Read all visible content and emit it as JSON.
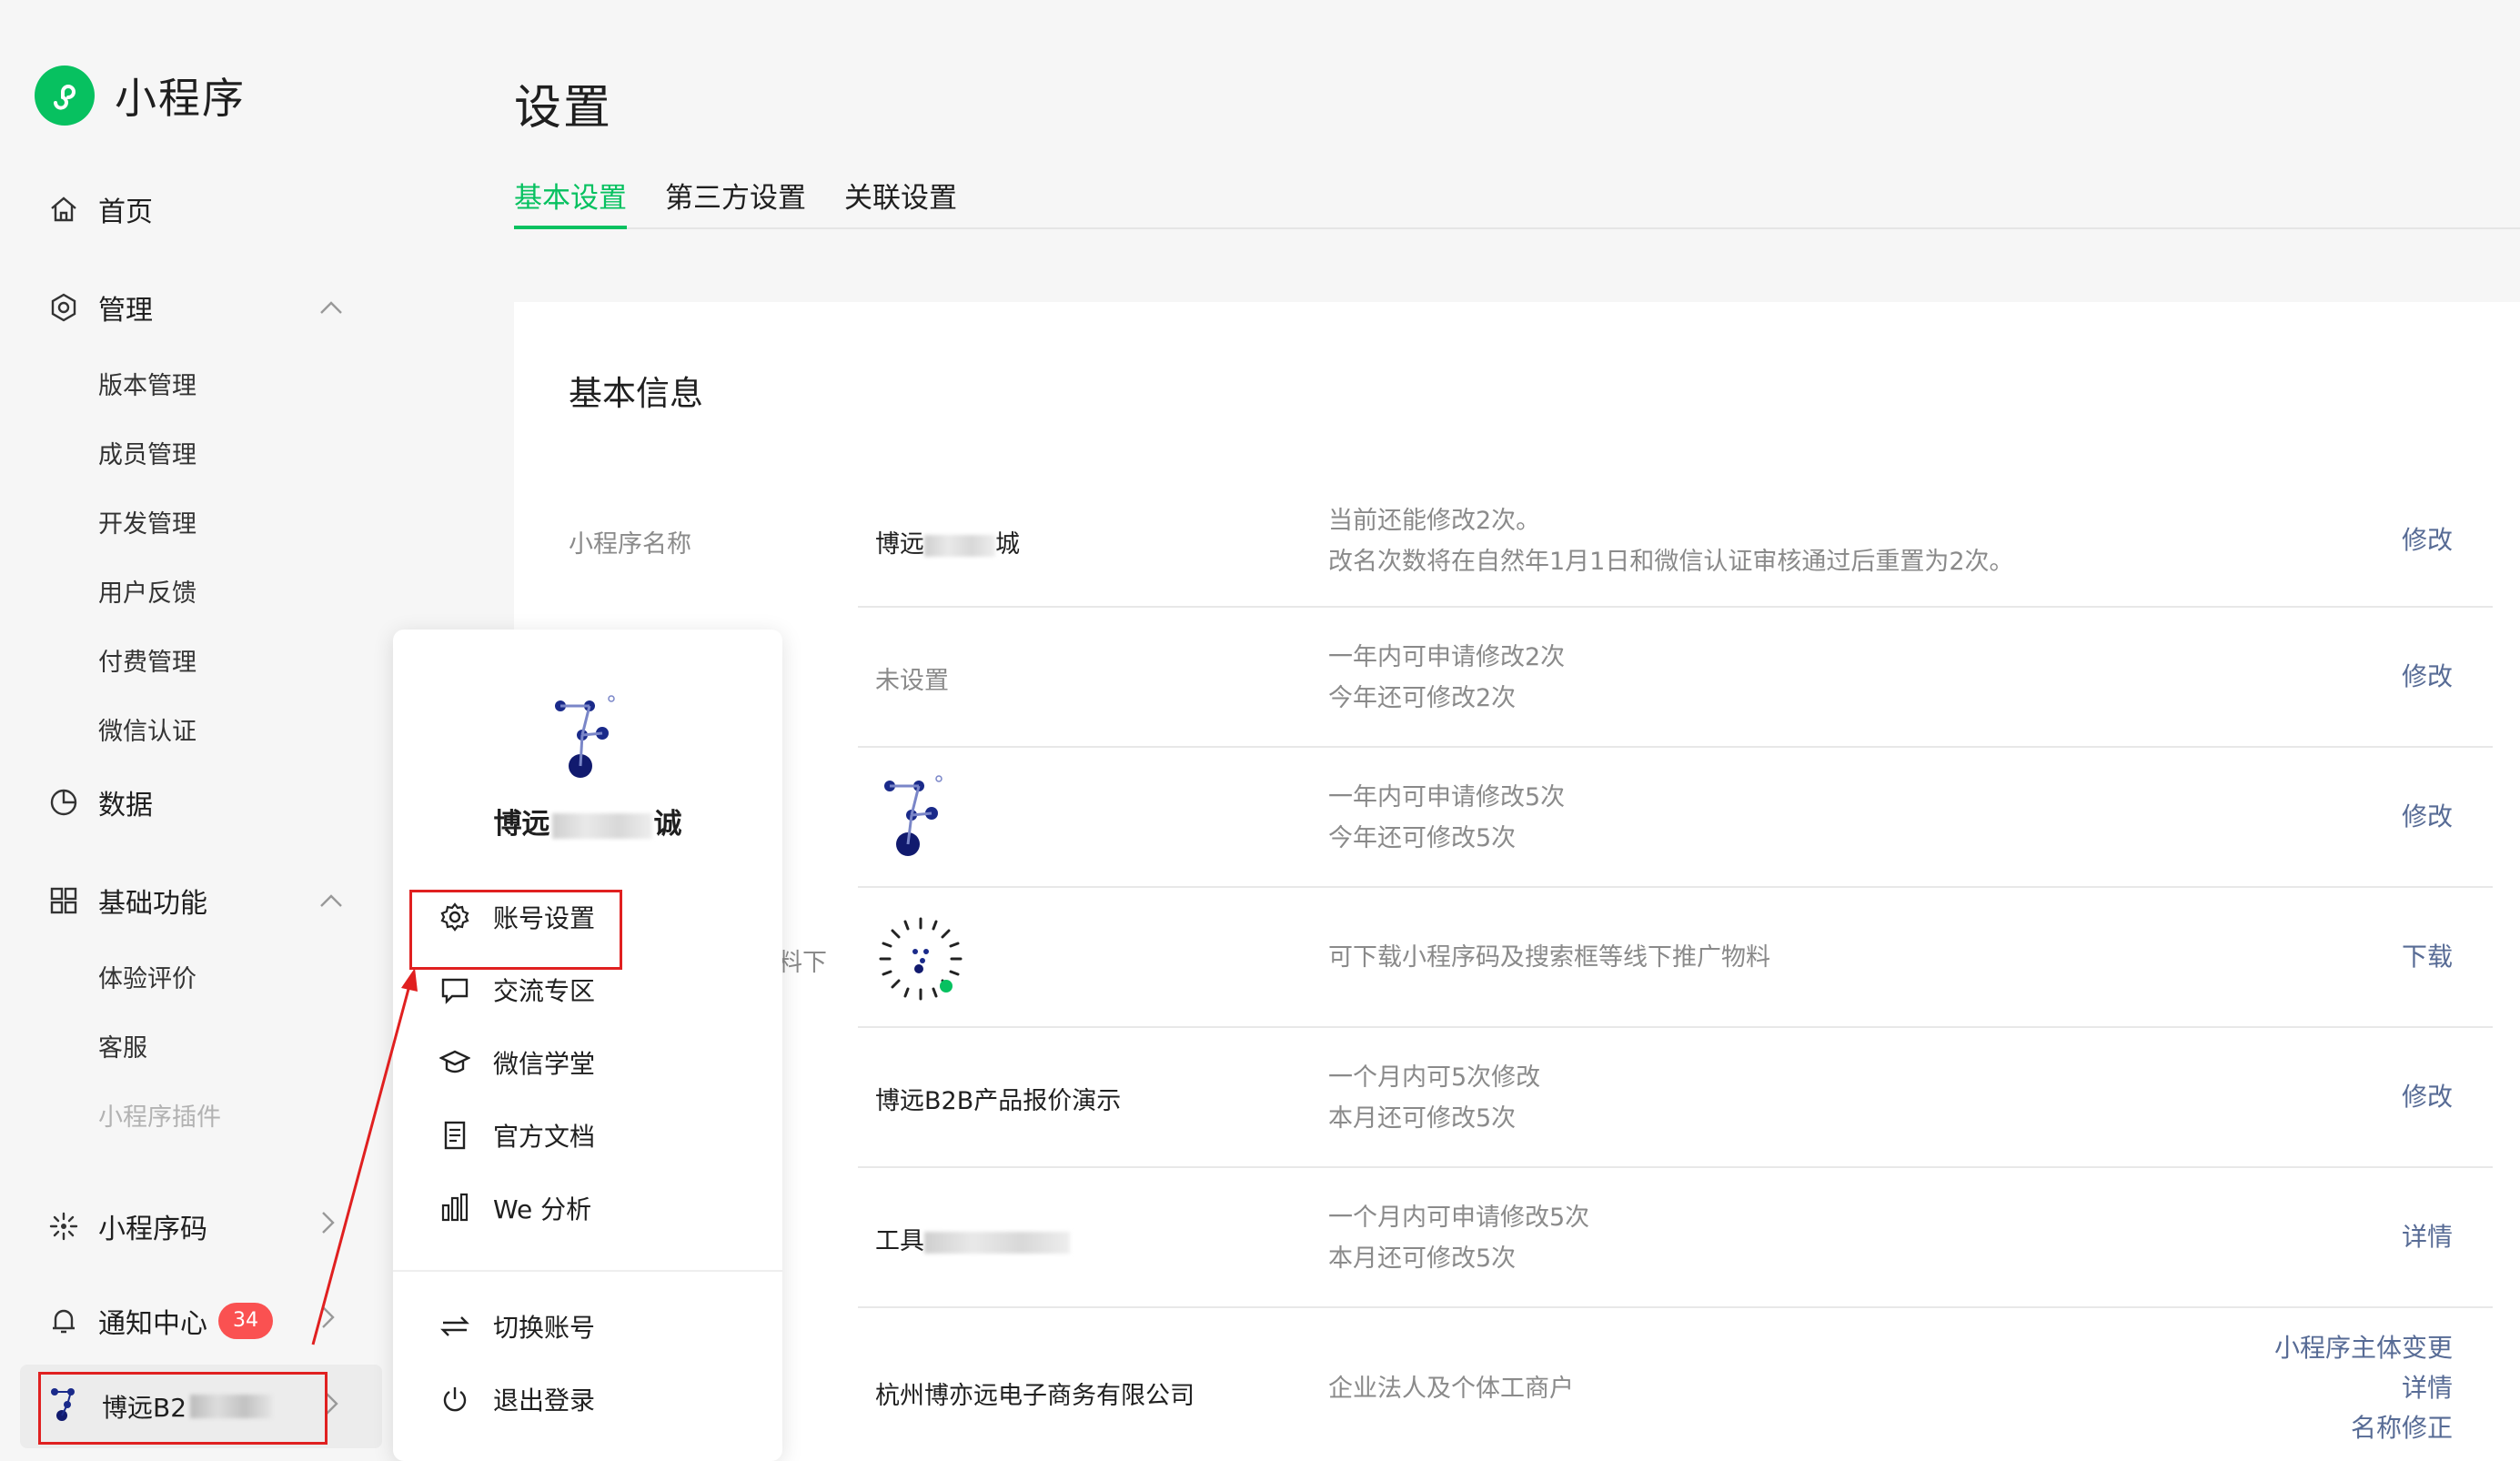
{
  "app": {
    "name": "小程序",
    "logo_icon": "mini-program-logo-icon",
    "accent": "#07c160"
  },
  "sidebar": {
    "home": "首页",
    "manage": {
      "label": "管理",
      "items": [
        "版本管理",
        "成员管理",
        "开发管理",
        "用户反馈",
        "付费管理",
        "微信认证"
      ]
    },
    "data": "数据",
    "basic": {
      "label": "基础功能",
      "items": [
        "体验评价",
        "客服"
      ],
      "disabled_item": "小程序插件"
    },
    "qrcode": "小程序码",
    "notify": {
      "label": "通知中心",
      "badge": "34",
      "badge_color": "#fa5151"
    },
    "account": {
      "name": "博远B2"
    }
  },
  "main": {
    "title": "设置",
    "tabs": [
      "基本设置",
      "第三方设置",
      "关联设置"
    ],
    "card_title": "基本信息",
    "rows": [
      {
        "label": "小程序名称",
        "value_a": "博远",
        "value_b": "城",
        "desc1": "当前还能修改2次。",
        "desc2": "改名次数将在自然年1月1日和微信认证审核通过后重置为2次。",
        "action": "修改"
      },
      {
        "value": "未设置",
        "desc1": "一年内可申请修改2次",
        "desc2": "今年还可修改2次",
        "action": "修改"
      },
      {
        "desc1": "一年内可申请修改5次",
        "desc2": "今年还可修改5次",
        "action": "修改"
      },
      {
        "label_partial": "料下",
        "desc1": "可下载小程序码及搜索框等线下推广物料",
        "action": "下载"
      },
      {
        "value": "博远B2B产品报价演示",
        "desc1": "一个月内可5次修改",
        "desc2": "本月还可修改5次",
        "action": "修改"
      },
      {
        "value": "工具",
        "desc1": "一个月内可申请修改5次",
        "desc2": "本月还可修改5次",
        "action": "详情"
      },
      {
        "value": "杭州博亦远电子商务有限公司",
        "desc1": "企业法人及个体工商户",
        "actions": [
          "小程序主体变更",
          "详情",
          "名称修正"
        ]
      }
    ]
  },
  "popup": {
    "name_a": "博远",
    "name_b": "诚",
    "items": [
      "账号设置",
      "交流专区",
      "微信学堂",
      "官方文档",
      "We 分析"
    ],
    "items2": [
      "切换账号",
      "退出登录"
    ]
  },
  "annotation_color": "#e02020"
}
